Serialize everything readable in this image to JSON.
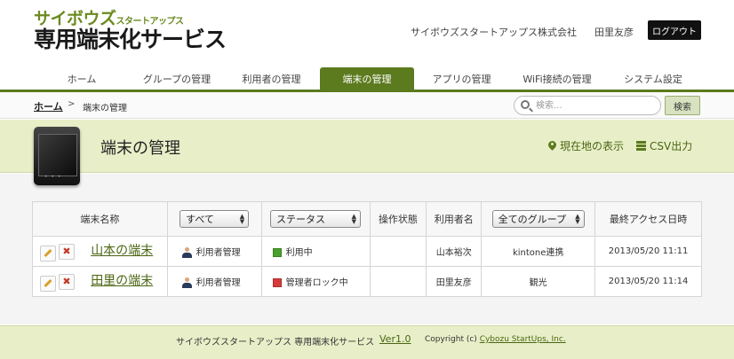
{
  "header": {
    "logo_line1": "サイボウズ",
    "logo_line1_small": "スタートアップス",
    "logo_line2": "専用端末化サービス",
    "company": "サイボウズスタートアップス株式会社",
    "username": "田里友彦",
    "logout": "ログアウト"
  },
  "nav": {
    "items": [
      {
        "label": "ホーム"
      },
      {
        "label": "グループの管理"
      },
      {
        "label": "利用者の管理"
      },
      {
        "label": "端末の管理"
      },
      {
        "label": "アプリの管理"
      },
      {
        "label": "WiFi接続の管理"
      },
      {
        "label": "システム設定"
      }
    ],
    "active": "端末の管理"
  },
  "breadcrumb": {
    "home": "ホーム",
    "sep": ">",
    "current": "端末の管理"
  },
  "search": {
    "placeholder": "検索...",
    "button": "検索"
  },
  "page": {
    "title": "端末の管理",
    "show_location": "現在地の表示",
    "csv_export": "CSV出力"
  },
  "table": {
    "headers": {
      "device_name": "端末名称",
      "filter_all": "すべて",
      "filter_status": "ステータス",
      "operation_state": "操作状態",
      "user_name": "利用者名",
      "filter_group": "全てのグループ",
      "last_access": "最終アクセス日時"
    },
    "rows": [
      {
        "name": "山本の端末",
        "type": "利用者管理",
        "status": "利用中",
        "status_color": "#4aa02c",
        "operation": "",
        "user": "山本裕次",
        "group": "kintone連携",
        "last_access": "2013/05/20 11:11"
      },
      {
        "name": "田里の端末",
        "type": "利用者管理",
        "status": "管理者ロック中",
        "status_color": "#d63a3a",
        "operation": "",
        "user": "田里友彦",
        "group": "観光",
        "last_access": "2013/05/20 11:14"
      }
    ]
  },
  "footer": {
    "service": "サイボウズスタートアップス 専用端末化サービス",
    "version": "Ver1.0",
    "copyright_prefix": "Copyright (c)",
    "copyright_link": "Cybozu StartUps, Inc."
  },
  "colors": {
    "accent": "#5c7a1e",
    "band": "#e8efc8"
  }
}
